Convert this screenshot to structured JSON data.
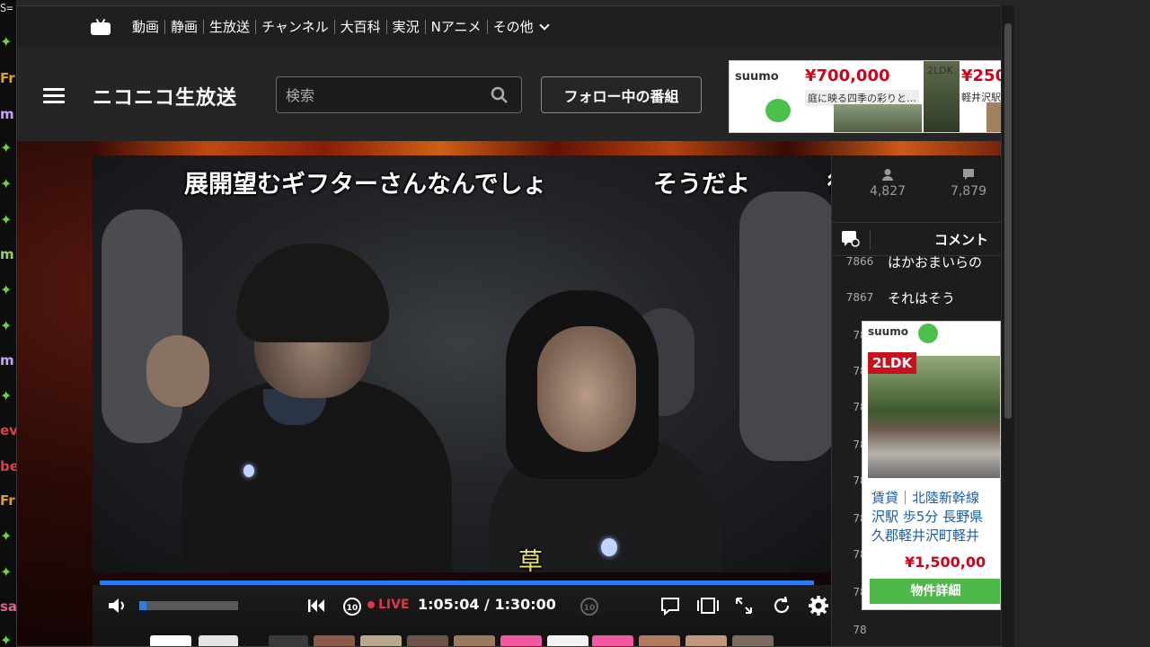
{
  "left_strip": {
    "top_text": "S=",
    "items": [
      {
        "text": "Fr",
        "color": "#e0a030"
      },
      {
        "text": "m",
        "color": "#c8a0ff"
      },
      {
        "text": "m",
        "color": "#8fd46a"
      },
      {
        "text": "m",
        "color": "#c8a0ff"
      },
      {
        "text": "ev",
        "color": "#e04040"
      },
      {
        "text": "be",
        "color": "#e04040"
      },
      {
        "text": "Fr",
        "color": "#e0a030"
      },
      {
        "text": "sa",
        "color": "#e06090"
      }
    ]
  },
  "nav": {
    "items": [
      "動画",
      "静画",
      "生放送",
      "チャンネル",
      "大百科",
      "実況",
      "Nアニメ",
      "その他"
    ]
  },
  "header": {
    "logo": "ニコニコ生放送",
    "search_placeholder": "検索",
    "follow_button": "フォロー中の番組"
  },
  "ad_top": {
    "brand": "suumo",
    "price1": "¥700,000",
    "desc1": "庭に映る四季の彩りと…",
    "tag2": "2LDK",
    "price2": "¥250",
    "desc2": "軽井沢駅"
  },
  "danmaku": {
    "line1": "展開望むギフターさんなんでしょ",
    "line2": "そうだよ",
    "line3": "得",
    "grass": "草"
  },
  "player": {
    "live_label": "LIVE",
    "time": "1:05:04 / 1:30:00",
    "progress_fraction": 0.99,
    "volume_fraction": 0.07
  },
  "side": {
    "viewers": "4,827",
    "comments_count": "7,879",
    "tab_comment": "コメント",
    "comments": [
      {
        "num": "7866",
        "text": "はかおまいらの"
      },
      {
        "num": "7867",
        "text": "それはそう"
      },
      {
        "num": "78",
        "text": ""
      },
      {
        "num": "78",
        "text": ""
      },
      {
        "num": "78",
        "text": ""
      },
      {
        "num": "78",
        "text": ""
      },
      {
        "num": "78",
        "text": ""
      },
      {
        "num": "78",
        "text": ""
      },
      {
        "num": "78",
        "text": ""
      },
      {
        "num": "78",
        "text": ""
      },
      {
        "num": "78",
        "text": ""
      },
      {
        "num": "78",
        "text": ""
      }
    ]
  },
  "ad_side": {
    "brand": "suumo",
    "tag": "2LDK",
    "desc_line1": "賃貸｜北陸新幹線",
    "desc_line2": "沢駅 歩5分 長野県",
    "desc_line3": "久郡軽井沢町軽井",
    "price": "¥1,500,00",
    "detail_button": "物件詳細"
  },
  "colors": {
    "accent": "#2a7df0",
    "live_red": "#e0364a",
    "suumo_green": "#4fb84a",
    "price_red": "#d0021b"
  }
}
